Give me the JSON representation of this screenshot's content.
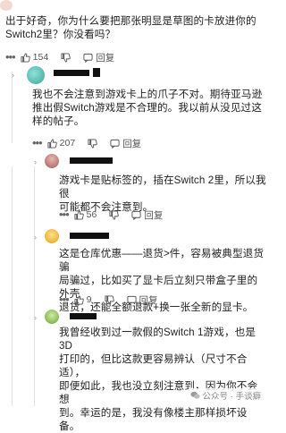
{
  "comments": [
    {
      "id": "c1",
      "text": "出于好奇，你为什么要把那张明显是草图的卡放进你的\nSwitch2里？你没看吗？",
      "likes": "154",
      "reply_label": "回复"
    },
    {
      "id": "c2",
      "text": "我也不会注意到游戏卡上的爪子不对。期待亚马逊\n推出假Switch游戏是不合理的。我以前从没见过这\n样的帖子。",
      "likes": "207",
      "reply_label": "回复"
    },
    {
      "id": "c3",
      "text": "游戏卡是贴标签的，插在Switch 2里，所以我很\n可能都不会注意到。",
      "likes": "56",
      "reply_label": "回复"
    },
    {
      "id": "c4",
      "text": "这是仓库优惠——退货>件，容易被典型退货骗\n局骗过，比如买了显卡后立刻只带盒子里的外壳\n退货，还能全额退款+换一张全新的显卡。",
      "likes": "9",
      "reply_label": "回复"
    },
    {
      "id": "c5",
      "text": "我曾经收到过一款假的Switch 1游戏，也是3D\n打印的，但比这款更容易辨认（尺寸不合适），\n即便如此，我也没立刻注意到，因为你不会想\n到。幸运的是，我没有像楼主那样损坏设备。"
    }
  ],
  "watermark": "公众号 · 手谈癖",
  "colors": {
    "text": "#222222",
    "meta": "#555555",
    "line": "#e3e3e3"
  }
}
